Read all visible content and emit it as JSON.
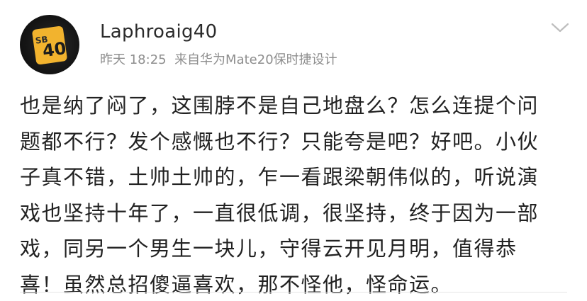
{
  "post": {
    "username": "Laphroaig40",
    "time": "昨天 18:25",
    "source": "来自华为Mate20保时捷设计",
    "avatar": {
      "badge_small_text": "SB",
      "badge_number": "40",
      "badge_color": "#f2b32e"
    },
    "menu_icon": "chevron-down-icon",
    "text_lines": [
      "也是纳了闷了，这围脖不是自己地盘么？怎么连提个问",
      "题都不行？发个感慨也不行？只能夸是吧？好吧。小伙",
      "子真不错，土帅土帅的，乍一看跟梁朝伟似的，听说演",
      "戏也坚持十年了，一直很低调，很坚持，终于因为一部",
      "戏，同另一个男生一块儿，守得云开见月明，值得恭",
      "喜！虽然总招傻逼喜欢，那不怪他，怪命运。"
    ]
  }
}
